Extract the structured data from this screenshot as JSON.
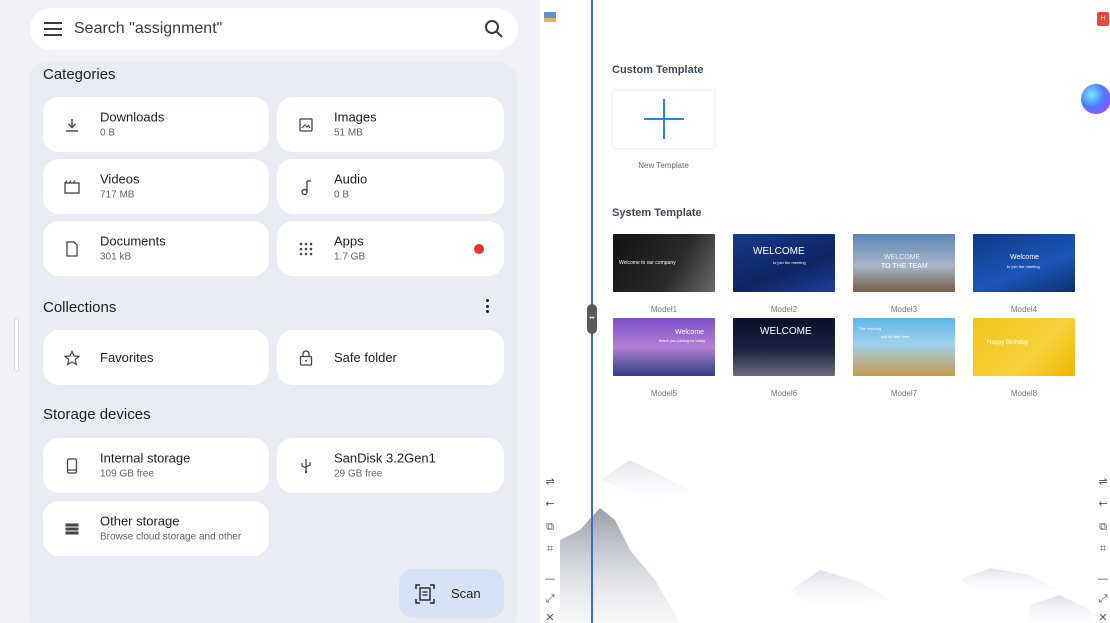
{
  "files": {
    "search_placeholder": "Search \"assignment\"",
    "categories_title": "Categories",
    "categories": [
      {
        "name": "Downloads",
        "size": "0 B",
        "icon": "download-icon"
      },
      {
        "name": "Images",
        "size": "51 MB",
        "icon": "image-icon"
      },
      {
        "name": "Videos",
        "size": "717 MB",
        "icon": "video-icon"
      },
      {
        "name": "Audio",
        "size": "0 B",
        "icon": "music-note-icon"
      },
      {
        "name": "Documents",
        "size": "301 kB",
        "icon": "document-icon"
      },
      {
        "name": "Apps",
        "size": "1.7 GB",
        "icon": "apps-grid-icon"
      }
    ],
    "collections_title": "Collections",
    "collections": [
      {
        "name": "Favorites",
        "icon": "star-icon"
      },
      {
        "name": "Safe folder",
        "icon": "lock-icon"
      }
    ],
    "storage_title": "Storage devices",
    "storage": [
      {
        "name": "Internal storage",
        "detail": "109 GB free",
        "icon": "phone-icon"
      },
      {
        "name": "SanDisk 3.2Gen1",
        "detail": "29 GB free",
        "icon": "usb-icon"
      },
      {
        "name": "Other storage",
        "detail": "Browse cloud storage and other",
        "icon": "storage-list-icon"
      }
    ],
    "scan_label": "Scan",
    "apps_badge_color": "#e5322d"
  },
  "templates": {
    "custom_title": "Custom Template",
    "new_template_label": "New Template",
    "system_title": "System Template",
    "models": [
      {
        "label": "Model1",
        "caption": "Welcome to our company"
      },
      {
        "label": "Model2",
        "caption": "WELCOME",
        "caption2": "to join the meeting"
      },
      {
        "label": "Model3",
        "caption": "WELCOME",
        "caption2": "TO THE TEAM"
      },
      {
        "label": "Model4",
        "caption": "Welcome",
        "caption2": "to join the meeting"
      },
      {
        "label": "Model5",
        "caption": "Welcome",
        "caption2": "thank you joining us today"
      },
      {
        "label": "Model6",
        "caption": "WELCOME"
      },
      {
        "label": "Model7",
        "caption": "The meeting",
        "caption2": "will be little here"
      },
      {
        "label": "Model8",
        "caption": "Happy Birthday"
      }
    ],
    "accent_color": "#2e6fd8"
  }
}
